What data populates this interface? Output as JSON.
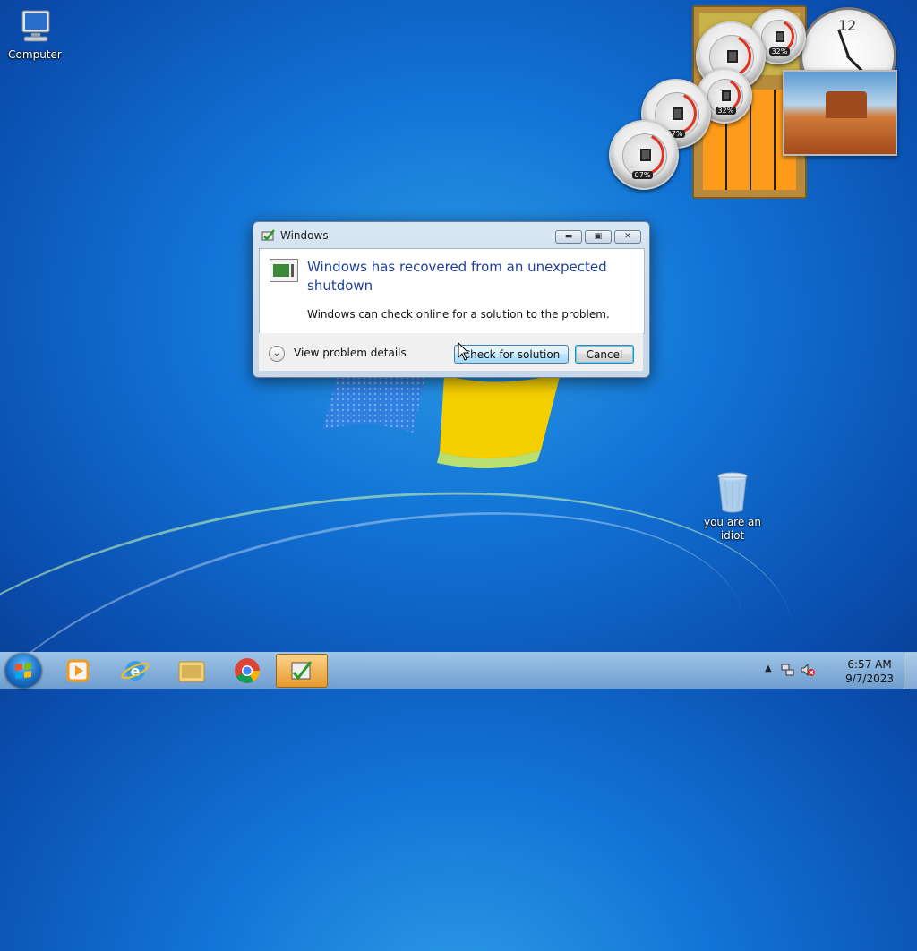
{
  "desktop": {
    "icons": [
      {
        "label": "Computer"
      },
      {
        "label": "you are an idiot"
      }
    ]
  },
  "gadgets": {
    "cpu_meters": [
      {
        "value": "32%"
      },
      {
        "value": "32%"
      },
      {
        "value": "07%"
      },
      {
        "value": "07%"
      }
    ],
    "clock": {
      "number": "12"
    }
  },
  "dialog": {
    "title": "Windows",
    "main_instruction": "Windows has recovered from an unexpected shutdown",
    "content": "Windows can check online for a solution to the problem.",
    "details_label": "View problem details",
    "buttons": {
      "check": "Check for solution",
      "cancel": "Cancel"
    }
  },
  "taskbar": {
    "items": [
      "start-orb",
      "windows-media-player",
      "internet-explorer",
      "windows-explorer",
      "google-chrome",
      "problem-reporting"
    ],
    "time": "6:57 AM",
    "date": "9/7/2023"
  },
  "colors": {
    "desktop": "#1274d6",
    "main_instruction": "#1f3f99",
    "taskbar_active": "#e59a2b"
  }
}
